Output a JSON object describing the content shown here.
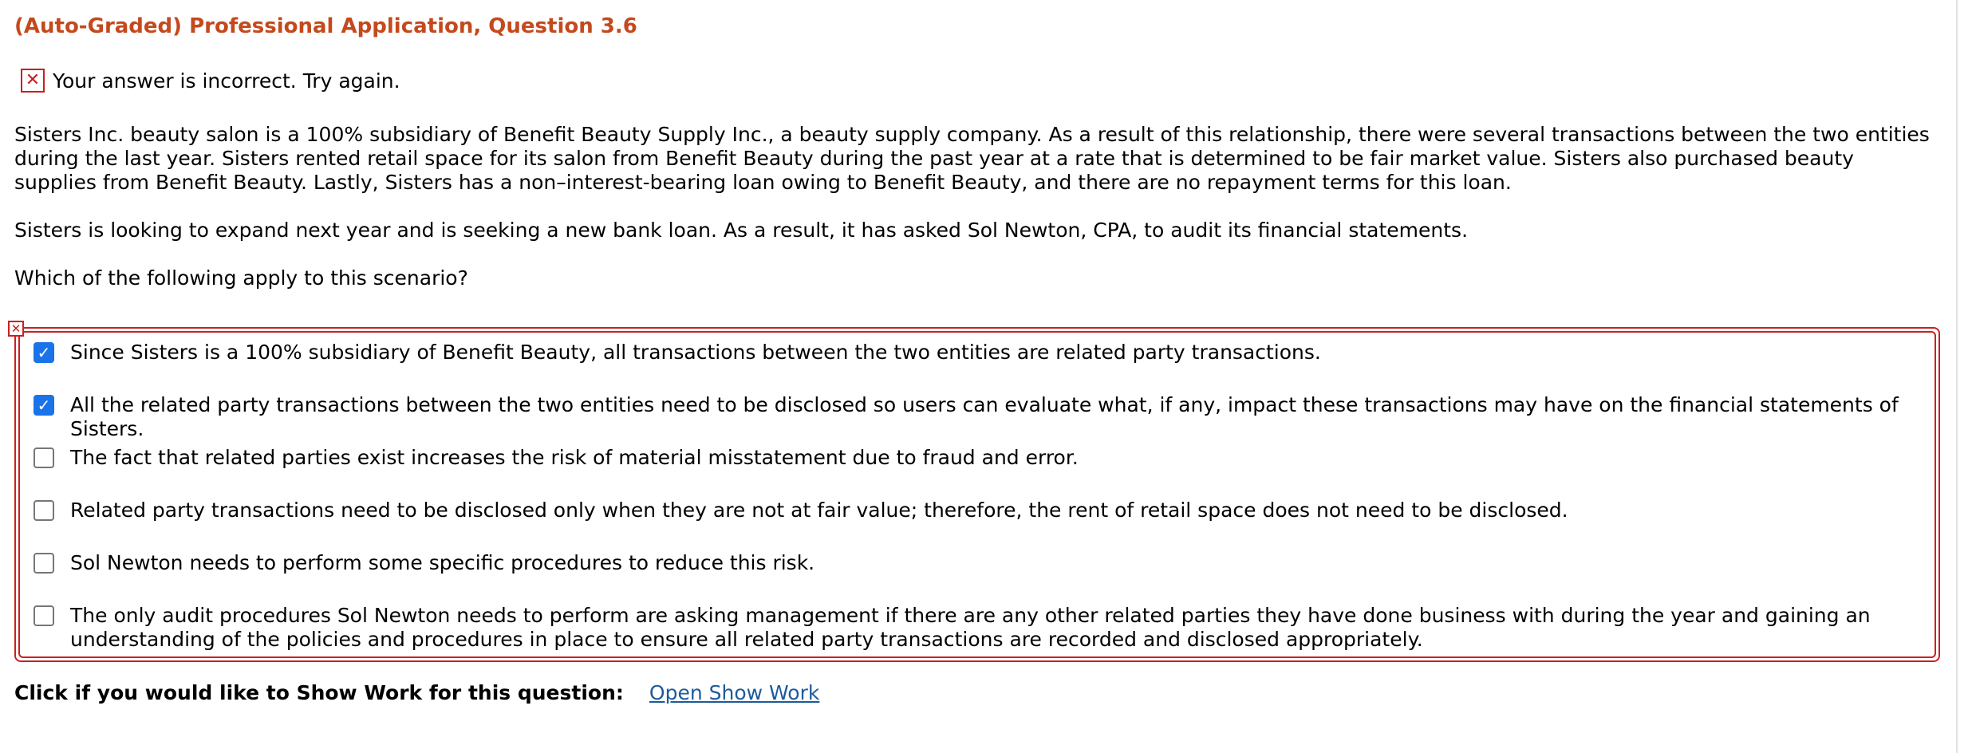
{
  "question": {
    "title": "(Auto-Graded) Professional Application, Question 3.6"
  },
  "feedback": {
    "icon": "x-mark-icon",
    "text": "Your answer is incorrect.  Try again.",
    "color": "#cc1f1f"
  },
  "scenario": {
    "paragraph1": "Sisters Inc. beauty salon is a 100% subsidiary of Benefit Beauty Supply Inc., a beauty supply company. As a result of this relationship, there were several transactions between the two entities during the last year. Sisters rented retail space for its salon from Benefit Beauty during the past year at a rate that is determined to be fair market value. Sisters also purchased beauty supplies from Benefit Beauty. Lastly, Sisters has a non–interest-bearing loan owing to Benefit Beauty, and there are no repayment terms for this loan.",
    "paragraph2": "Sisters is looking to expand next year and is seeking a new bank loan. As a result, it has asked Sol Newton, CPA, to audit its financial statements.",
    "prompt": "Which of the following apply to this scenario?"
  },
  "options": [
    {
      "text": "Since Sisters is a 100% subsidiary of Benefit Beauty, all transactions between the two entities are related party transactions.",
      "checked": true
    },
    {
      "text": "All the related party transactions between the two entities need to be disclosed so users can evaluate what, if any, impact these transactions may have on the financial statements of Sisters.",
      "checked": true
    },
    {
      "text": "The fact that related parties exist increases the risk of material misstatement due to fraud and error.",
      "checked": false
    },
    {
      "text": "Related party transactions need to be disclosed only when they are not at fair value; therefore, the rent of retail space does not need to be disclosed.",
      "checked": false
    },
    {
      "text": "Sol Newton needs to perform some specific procedures to reduce this risk.",
      "checked": false
    },
    {
      "text": "The only audit procedures Sol Newton needs to perform are asking management if there are any other related parties they have done business with during the year and gaining an understanding of the policies and procedures in place to ensure all related party transactions are recorded and disclosed appropriately.",
      "checked": false
    }
  ],
  "show_work": {
    "label": "Click if you would like to Show Work for this question:",
    "link": "Open Show Work"
  },
  "colors": {
    "title": "#c4491d",
    "error": "#cc1f1f",
    "checkbox_checked": "#1a73e8",
    "link": "#1d5b9b"
  }
}
